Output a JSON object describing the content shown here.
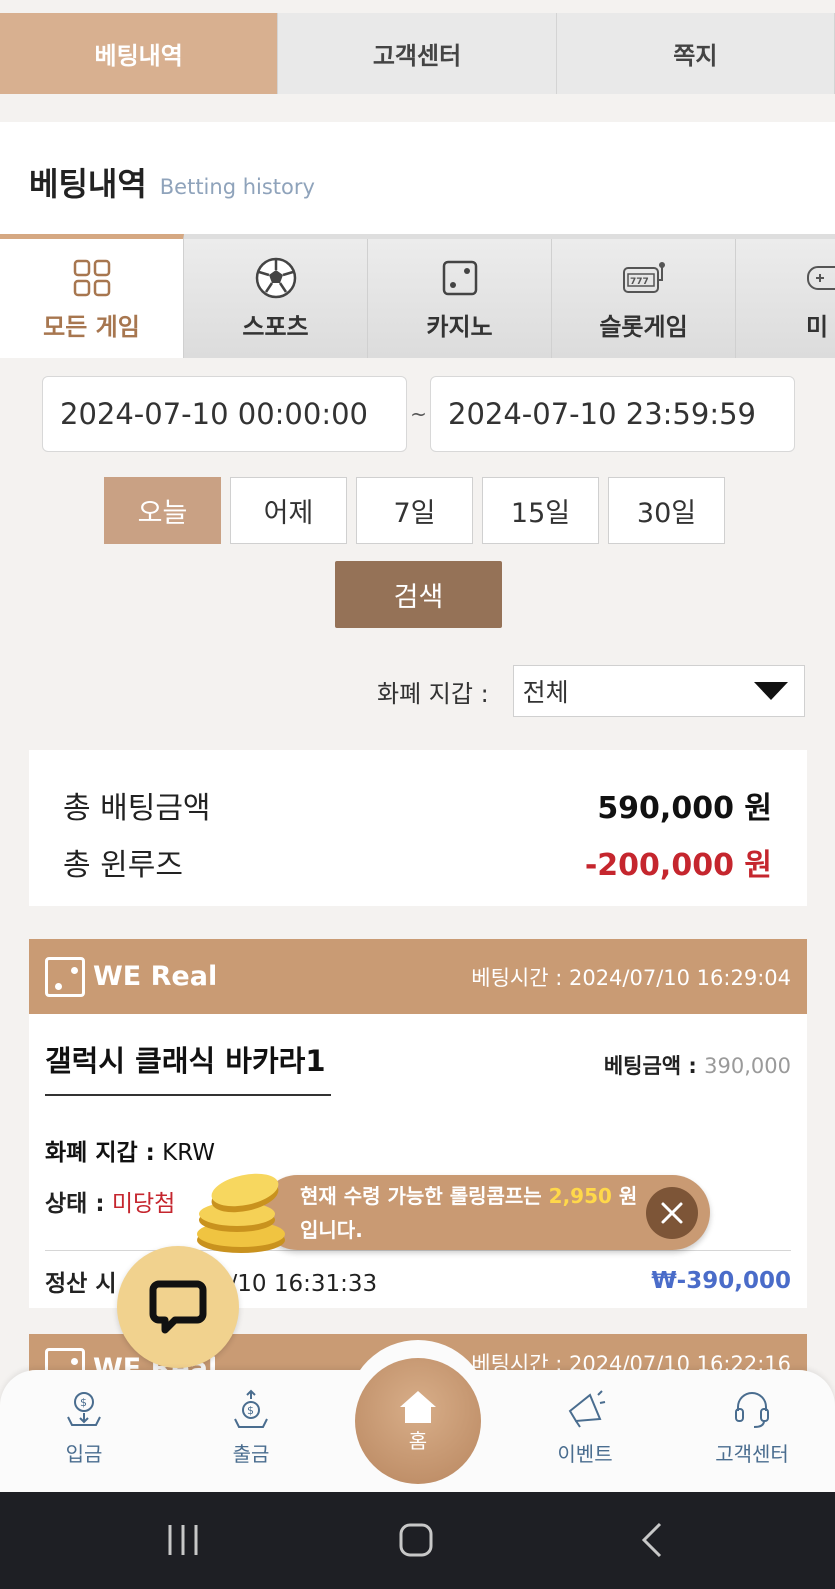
{
  "top_tabs": [
    {
      "label": "베팅내역",
      "active": true
    },
    {
      "label": "고객센터",
      "active": false
    },
    {
      "label": "쪽지",
      "active": false
    }
  ],
  "page_title": {
    "ko": "베팅내역",
    "en": "Betting history"
  },
  "game_tabs": [
    {
      "label": "모든 게임",
      "icon": "grid-icon",
      "active": true
    },
    {
      "label": "스포츠",
      "icon": "soccer-ball-icon"
    },
    {
      "label": "카지노",
      "icon": "dice-icon"
    },
    {
      "label": "슬롯게임",
      "icon": "slot-machine-icon"
    },
    {
      "label": "미",
      "icon": "gamepad-icon"
    }
  ],
  "date_range": {
    "start": "2024-07-10 00:00:00",
    "separator": "~",
    "end": "2024-07-10 23:59:59"
  },
  "periods": [
    {
      "label": "오늘",
      "active": true
    },
    {
      "label": "어제"
    },
    {
      "label": "7일"
    },
    {
      "label": "15일"
    },
    {
      "label": "30일"
    }
  ],
  "search_label": "검색",
  "wallet": {
    "label": "화폐 지갑 :",
    "selected": "전체"
  },
  "summary": {
    "total_bet_label": "총 배팅금액",
    "total_bet_value": "590,000 원",
    "total_winloss_label": "총 윈루즈",
    "total_winloss_value": "-200,000 원"
  },
  "bet_card": {
    "provider": "WE Real",
    "bet_time_label": "베팅시간 :",
    "bet_time": "2024/07/10 16:29:04",
    "game_name": "갤럭시 클래식 바카라1",
    "bet_amount_label": "베팅금액 :",
    "bet_amount": "390,000",
    "wallet_label": "화폐 지갑 :",
    "wallet_value": "KRW",
    "status_label": "상태 :",
    "status_value": "미당첨",
    "settle_label": "정산 시",
    "settle_time": "/07/10 16:31:33",
    "settle_amount": "₩-390,000"
  },
  "bet_card_2": {
    "provider": "WE Real",
    "bet_time_text": "베팅시간 : 2024/07/10 16:22:16"
  },
  "toast": {
    "text_before": "현재 수령 가능한 롤링콤프는 ",
    "amount": "2,950",
    "unit": " 원",
    "line2": "입니다."
  },
  "bottom_nav": [
    {
      "label": "입금",
      "icon": "deposit-icon"
    },
    {
      "label": "출금",
      "icon": "withdraw-icon"
    },
    {
      "label": "홈",
      "icon": "home-icon"
    },
    {
      "label": "이벤트",
      "icon": "megaphone-icon"
    },
    {
      "label": "고객센터",
      "icon": "headset-icon"
    }
  ],
  "colors": {
    "accent": "#c99b74",
    "active_tab": "#d8b090",
    "search": "#957257",
    "negative": "#c5262e",
    "settle": "#4a6cc9"
  }
}
